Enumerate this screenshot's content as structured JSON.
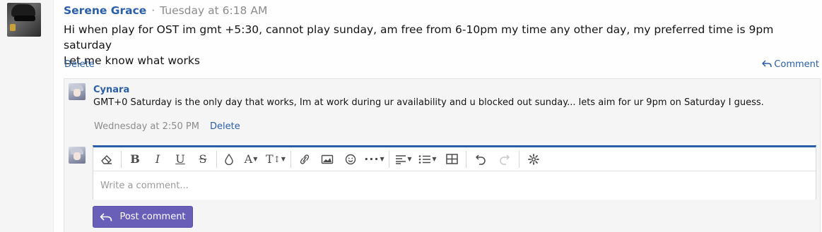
{
  "post": {
    "author": "Serene Grace",
    "separator": "·",
    "time": "Tuesday at 6:18 AM",
    "lines": [
      "Hi when play for OST im gmt +5:30, cannot play sunday, am free from 6-10pm my time any other day, my preferred time is 9pm saturday",
      "Let me know what works"
    ],
    "delete_label": "Delete",
    "comment_label": "Comment"
  },
  "comment": {
    "author": "Cynara",
    "text": "GMT+0 Saturday is the only day that works, Im at work during ur availability and u blocked out sunday... lets aim for ur 9pm on Saturday I guess.",
    "time": "Wednesday at 2:50 PM",
    "delete_label": "Delete"
  },
  "editor": {
    "placeholder": "Write a comment...",
    "toolbar_icons": [
      "eraser-icon",
      "bold-icon",
      "italic-icon",
      "underline-icon",
      "strikethrough-icon",
      "color-drop-icon",
      "font-family-icon",
      "font-size-icon",
      "link-icon",
      "image-icon",
      "emoji-icon",
      "more-icon",
      "align-icon",
      "list-icon",
      "table-icon",
      "undo-icon",
      "redo-icon",
      "settings-icon"
    ],
    "post_button_label": "Post comment"
  },
  "colors": {
    "link": "#2a5fa8",
    "button": "#6a5fb8",
    "muted": "#8c8c8c"
  }
}
